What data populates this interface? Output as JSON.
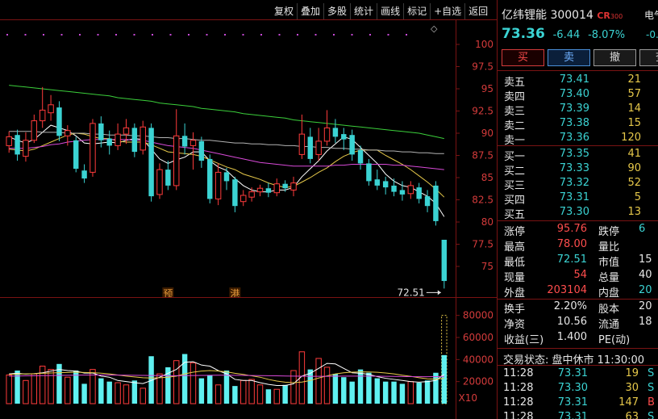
{
  "toolbar": [
    "复权",
    "叠加",
    "多股",
    "统计",
    "画线",
    "标记",
    "+自选",
    "返回"
  ],
  "stock": {
    "name": "亿纬锂能",
    "code": "300014",
    "badge": "CR",
    "badge_sub": "300",
    "side_label": "电气",
    "side_value": "-0.",
    "price": "73.36",
    "change": "-6.44",
    "change_pct": "-8.07%"
  },
  "trade_buttons": [
    "买",
    "卖",
    "撤",
    "查"
  ],
  "asks": [
    {
      "label": "卖五",
      "price": "73.41",
      "volume": "21"
    },
    {
      "label": "卖四",
      "price": "73.40",
      "volume": "57"
    },
    {
      "label": "卖三",
      "price": "73.39",
      "volume": "14"
    },
    {
      "label": "卖二",
      "price": "73.38",
      "volume": "15"
    },
    {
      "label": "卖一",
      "price": "73.36",
      "volume": "120"
    }
  ],
  "bids": [
    {
      "label": "买一",
      "price": "73.35",
      "volume": "41"
    },
    {
      "label": "买二",
      "price": "73.33",
      "volume": "90"
    },
    {
      "label": "买三",
      "price": "73.32",
      "volume": "52"
    },
    {
      "label": "买四",
      "price": "73.31",
      "volume": "5"
    },
    {
      "label": "买五",
      "price": "73.30",
      "volume": "13"
    }
  ],
  "stats1": [
    {
      "l1": "涨停",
      "v1": "95.76",
      "c1": "up",
      "l2": "跌停",
      "v2": "6",
      "c2": "dn"
    },
    {
      "l1": "最高",
      "v1": "78.00",
      "c1": "up",
      "l2": "量比",
      "v2": "",
      "c2": "wh"
    },
    {
      "l1": "最低",
      "v1": "72.51",
      "c1": "dn",
      "l2": "市值",
      "v2": "15",
      "c2": "wh"
    },
    {
      "l1": "现量",
      "v1": "54",
      "c1": "up",
      "l2": "总量",
      "v2": "40",
      "c2": "wh"
    },
    {
      "l1": "外盘",
      "v1": "203104",
      "c1": "up",
      "l2": "内盘",
      "v2": "20",
      "c2": "dn"
    }
  ],
  "stats2": [
    {
      "l1": "换手",
      "v1": "2.20%",
      "c1": "wh",
      "l2": "股本",
      "v2": "20",
      "c2": "wh"
    },
    {
      "l1": "净资",
      "v1": "10.56",
      "c1": "wh",
      "l2": "流通",
      "v2": "18",
      "c2": "wh"
    },
    {
      "l1": "收益(三)",
      "v1": "1.400",
      "c1": "wh",
      "l2": "PE(动)",
      "v2": "",
      "c2": "wh"
    }
  ],
  "status": {
    "label": "交易状态:",
    "value": "盘中休市 11:30:00"
  },
  "ticks": [
    {
      "time": "11:28",
      "price": "73.31",
      "qty": "19",
      "side": "S"
    },
    {
      "time": "11:28",
      "price": "73.30",
      "qty": "30",
      "side": "S"
    },
    {
      "time": "11:28",
      "price": "73.31",
      "qty": "147",
      "side": "B"
    },
    {
      "time": "11:28",
      "price": "73.31",
      "qty": "63",
      "side": "S"
    }
  ],
  "chart_data": [
    {
      "type": "candlestick",
      "ylim": [
        72,
        102
      ],
      "yticks": [
        75.0,
        77.5,
        80.0,
        82.5,
        85.0,
        87.5,
        90.0,
        92.5,
        95.0,
        97.5,
        100.0
      ],
      "grid": false,
      "candles": [
        {
          "o": 88.6,
          "c": 89.6,
          "h": 90.2,
          "l": 87.8
        },
        {
          "o": 89.8,
          "c": 87.6,
          "h": 90.4,
          "l": 86.9
        },
        {
          "o": 87.4,
          "c": 89.2,
          "h": 90.1,
          "l": 86.8
        },
        {
          "o": 89.2,
          "c": 91.4,
          "h": 92.1,
          "l": 88.9
        },
        {
          "o": 91.4,
          "c": 92.6,
          "h": 95.2,
          "l": 90.6
        },
        {
          "o": 92.3,
          "c": 93.2,
          "h": 94.3,
          "l": 91.4
        },
        {
          "o": 92.9,
          "c": 89.7,
          "h": 93.6,
          "l": 89.1
        },
        {
          "o": 89.7,
          "c": 90.3,
          "h": 90.9,
          "l": 88.6
        },
        {
          "o": 89.2,
          "c": 86.0,
          "h": 89.6,
          "l": 85.6
        },
        {
          "o": 85.8,
          "c": 84.9,
          "h": 86.5,
          "l": 84.4
        },
        {
          "o": 85.6,
          "c": 91.1,
          "h": 91.6,
          "l": 85.1
        },
        {
          "o": 91.1,
          "c": 89.2,
          "h": 91.9,
          "l": 88.4
        },
        {
          "o": 89.4,
          "c": 88.6,
          "h": 90.3,
          "l": 87.6
        },
        {
          "o": 88.6,
          "c": 89.9,
          "h": 91.1,
          "l": 88.1
        },
        {
          "o": 89.9,
          "c": 90.6,
          "h": 91.6,
          "l": 88.8
        },
        {
          "o": 90.6,
          "c": 87.9,
          "h": 91.1,
          "l": 87.3
        },
        {
          "o": 88.1,
          "c": 90.7,
          "h": 91.4,
          "l": 87.6
        },
        {
          "o": 90.6,
          "c": 82.9,
          "h": 91.1,
          "l": 82.3
        },
        {
          "o": 83.1,
          "c": 85.9,
          "h": 86.6,
          "l": 82.6
        },
        {
          "o": 85.9,
          "c": 84.1,
          "h": 86.9,
          "l": 83.6
        },
        {
          "o": 84.1,
          "c": 89.7,
          "h": 92.7,
          "l": 83.6
        },
        {
          "o": 89.7,
          "c": 88.5,
          "h": 91.1,
          "l": 87.6
        },
        {
          "o": 88.6,
          "c": 89.2,
          "h": 90.1,
          "l": 85.9
        },
        {
          "o": 89.1,
          "c": 86.9,
          "h": 89.6,
          "l": 86.1
        },
        {
          "o": 87.1,
          "c": 82.6,
          "h": 87.6,
          "l": 82.1
        },
        {
          "o": 82.6,
          "c": 85.6,
          "h": 86.6,
          "l": 81.9
        },
        {
          "o": 85.6,
          "c": 84.6,
          "h": 86.1,
          "l": 83.6
        },
        {
          "o": 84.8,
          "c": 81.8,
          "h": 85.1,
          "l": 81.1
        },
        {
          "o": 82.3,
          "c": 83.0,
          "h": 83.6,
          "l": 81.8
        },
        {
          "o": 82.8,
          "c": 83.4,
          "h": 83.9,
          "l": 82.3
        },
        {
          "o": 83.4,
          "c": 83.8,
          "h": 84.2,
          "l": 82.9
        },
        {
          "o": 83.8,
          "c": 83.3,
          "h": 84.4,
          "l": 82.8
        },
        {
          "o": 83.3,
          "c": 84.3,
          "h": 84.9,
          "l": 82.9
        },
        {
          "o": 84.3,
          "c": 83.8,
          "h": 84.7,
          "l": 83.4
        },
        {
          "o": 83.6,
          "c": 84.4,
          "h": 85.1,
          "l": 82.9
        },
        {
          "o": 87.6,
          "c": 89.9,
          "h": 92.1,
          "l": 87.1
        },
        {
          "o": 89.6,
          "c": 87.1,
          "h": 90.6,
          "l": 86.6
        },
        {
          "o": 87.6,
          "c": 89.1,
          "h": 90.6,
          "l": 86.9
        },
        {
          "o": 89.1,
          "c": 90.6,
          "h": 92.6,
          "l": 88.6
        },
        {
          "o": 90.6,
          "c": 89.6,
          "h": 91.6,
          "l": 88.9
        },
        {
          "o": 89.9,
          "c": 89.3,
          "h": 90.6,
          "l": 88.1
        },
        {
          "o": 89.8,
          "c": 87.6,
          "h": 90.4,
          "l": 86.9
        },
        {
          "o": 88.1,
          "c": 86.6,
          "h": 88.6,
          "l": 85.9
        },
        {
          "o": 86.6,
          "c": 84.6,
          "h": 87.1,
          "l": 84.1
        },
        {
          "o": 84.8,
          "c": 84.1,
          "h": 85.9,
          "l": 83.6
        },
        {
          "o": 84.6,
          "c": 83.9,
          "h": 85.1,
          "l": 83.1
        },
        {
          "o": 84.1,
          "c": 83.4,
          "h": 84.9,
          "l": 82.9
        },
        {
          "o": 83.6,
          "c": 83.1,
          "h": 84.6,
          "l": 82.4
        },
        {
          "o": 83.2,
          "c": 84.1,
          "h": 84.6,
          "l": 82.6
        },
        {
          "o": 83.9,
          "c": 82.6,
          "h": 84.4,
          "l": 82.1
        },
        {
          "o": 82.9,
          "c": 81.8,
          "h": 83.6,
          "l": 81.1
        },
        {
          "o": 84.1,
          "c": 80.1,
          "h": 84.6,
          "l": 79.6
        },
        {
          "o": 78.0,
          "c": 73.36,
          "h": 78.0,
          "l": 72.51
        }
      ],
      "ma_lines": [
        {
          "color": "#ffffff",
          "values": [
            89.6,
            89.2,
            88.9,
            89.3,
            90.1,
            90.9,
            90.6,
            90.3,
            89.7,
            88.9,
            88.8,
            88.9,
            89.0,
            88.9,
            89.2,
            89.4,
            89.3,
            88.2,
            87.1,
            86.6,
            87.0,
            87.3,
            87.9,
            87.9,
            86.9,
            86.2,
            85.8,
            84.9,
            84.1,
            83.6,
            83.4,
            83.4,
            83.6,
            83.6,
            83.9,
            85.1,
            86.0,
            86.9,
            88.0,
            88.8,
            89.6,
            89.3,
            88.4,
            87.5,
            86.6,
            85.4,
            84.6,
            84.1,
            83.9,
            83.4,
            82.9,
            82.1,
            80.6
          ]
        },
        {
          "color": "#e6c84a",
          "values": [
            88.2,
            88.1,
            88.0,
            88.2,
            88.6,
            89.0,
            89.4,
            89.8,
            90.0,
            89.9,
            89.6,
            89.4,
            89.4,
            89.1,
            89.0,
            89.0,
            89.0,
            88.7,
            88.3,
            87.9,
            87.8,
            87.7,
            87.6,
            87.4,
            87.0,
            86.6,
            86.2,
            85.9,
            85.4,
            85.1,
            84.8,
            84.4,
            84.1,
            83.9,
            84.0,
            84.5,
            85.0,
            85.6,
            86.1,
            86.8,
            87.4,
            87.8,
            88.1,
            88.1,
            88.1,
            87.5,
            87.0,
            86.5,
            85.9,
            85.2,
            84.5,
            83.7,
            82.8
          ]
        },
        {
          "color": "#d84ad8",
          "values": [
            88.3,
            88.3,
            88.3,
            88.4,
            88.5,
            88.7,
            88.8,
            89.0,
            89.1,
            89.2,
            89.3,
            89.3,
            89.3,
            89.3,
            89.3,
            89.2,
            89.2,
            89.0,
            88.8,
            88.6,
            88.5,
            88.4,
            88.3,
            88.1,
            87.9,
            87.7,
            87.5,
            87.3,
            87.1,
            86.9,
            86.7,
            86.6,
            86.5,
            86.4,
            86.3,
            86.3,
            86.3,
            86.3,
            86.3,
            86.4,
            86.4,
            86.5,
            86.5,
            86.5,
            86.5,
            86.5,
            86.4,
            86.4,
            86.3,
            86.2,
            86.1,
            86.0,
            85.9
          ]
        },
        {
          "color": "#3bcf3b",
          "values": [
            95.4,
            95.3,
            95.2,
            95.1,
            95.0,
            94.9,
            94.8,
            94.7,
            94.6,
            94.5,
            94.4,
            94.3,
            94.2,
            94.0,
            93.9,
            93.8,
            93.7,
            93.6,
            93.4,
            93.3,
            93.2,
            93.1,
            93.0,
            92.8,
            92.7,
            92.6,
            92.5,
            92.4,
            92.2,
            92.1,
            92.0,
            91.9,
            91.8,
            91.7,
            91.5,
            91.4,
            91.3,
            91.2,
            91.1,
            91.0,
            90.9,
            90.8,
            90.7,
            90.6,
            90.5,
            90.4,
            90.3,
            90.2,
            90.1,
            90.0,
            89.8,
            89.6,
            89.4
          ]
        },
        {
          "color": "#b3b3b3",
          "values": [
            90.2,
            90.2,
            90.2,
            90.2,
            90.1,
            90.1,
            90.1,
            90.0,
            90.0,
            90.0,
            89.9,
            89.9,
            89.8,
            89.8,
            89.8,
            89.7,
            89.7,
            89.6,
            89.5,
            89.5,
            89.4,
            89.4,
            89.3,
            89.2,
            89.2,
            89.1,
            89.0,
            88.9,
            88.9,
            88.8,
            88.8,
            88.7,
            88.7,
            88.6,
            88.6,
            88.5,
            88.5,
            88.4,
            88.4,
            88.3,
            88.3,
            88.2,
            88.2,
            88.1,
            88.1,
            88.0,
            88.0,
            87.9,
            87.9,
            87.8,
            87.8,
            87.7,
            87.7
          ]
        }
      ],
      "annotations": [
        {
          "text": "72.51",
          "kind": "low"
        },
        {
          "text": "预",
          "index": 19
        },
        {
          "text": "港",
          "index": 27
        }
      ]
    },
    {
      "type": "bar",
      "ylim": [
        0,
        90000
      ],
      "yticks": [
        20000,
        40000,
        60000,
        80000
      ],
      "unit": "X10",
      "grid": false,
      "values": [
        26000,
        30000,
        21000,
        27000,
        34000,
        31000,
        36000,
        24000,
        30000,
        18000,
        31000,
        23000,
        20000,
        19000,
        17000,
        21000,
        14000,
        43000,
        27000,
        33000,
        39000,
        45000,
        37000,
        23000,
        26000,
        17000,
        30000,
        16000,
        21000,
        22000,
        17000,
        13000,
        13000,
        17000,
        30000,
        47000,
        31000,
        41000,
        33000,
        27000,
        24000,
        20000,
        31000,
        28000,
        23000,
        20000,
        20000,
        18000,
        20000,
        19000,
        21000,
        28000,
        44000
      ],
      "extra_bar": {
        "index": 52,
        "value": 80000,
        "style": "dotted"
      },
      "ma_lines": [
        {
          "color": "#ffffff",
          "values": [
            27000,
            27500,
            26800,
            27200,
            28000,
            29500,
            31000,
            30000,
            29500,
            27700,
            27800,
            25000,
            24000,
            21000,
            20000,
            19000,
            18200,
            21000,
            24000,
            27500,
            31000,
            37500,
            38000,
            35000,
            34000,
            30000,
            27000,
            22000,
            21000,
            21000,
            19000,
            17500,
            16500,
            16500,
            18000,
            25000,
            27500,
            32000,
            36500,
            36000,
            32000,
            28000,
            27500,
            26500,
            24500,
            23000,
            22000,
            21000,
            20000,
            19500,
            20000,
            21000,
            26500
          ]
        },
        {
          "color": "#e6c84a",
          "values": [
            26500,
            26800,
            27000,
            27200,
            27500,
            27800,
            28100,
            28300,
            28500,
            28300,
            28100,
            27600,
            27000,
            26000,
            25000,
            24200,
            23500,
            23200,
            23500,
            24000,
            25000,
            27000,
            28500,
            29500,
            30000,
            29500,
            28800,
            27500,
            26500,
            25200,
            24000,
            22000,
            20500,
            19500,
            19000,
            19600,
            21000,
            23200,
            25200,
            27000,
            28000,
            28500,
            28800,
            28700,
            28400,
            27800,
            27000,
            25800,
            24800,
            23500,
            22500,
            22200,
            23000
          ]
        },
        {
          "color": "#d84ad8",
          "values": [
            25000,
            25100,
            25200,
            25300,
            25400,
            25500,
            25600,
            25700,
            25800,
            25900,
            26000,
            26000,
            26000,
            25900,
            25800,
            25700,
            25600,
            25500,
            25400,
            25300,
            25300,
            25400,
            25500,
            25600,
            25700,
            25800,
            25800,
            25700,
            25600,
            25500,
            25400,
            25300,
            25200,
            25100,
            25000,
            24900,
            24800,
            24800,
            24800,
            24900,
            25000,
            25000,
            25000,
            25000,
            24900,
            24800,
            24700,
            24600,
            24500,
            24400,
            24400,
            24500,
            24700
          ]
        }
      ]
    }
  ]
}
